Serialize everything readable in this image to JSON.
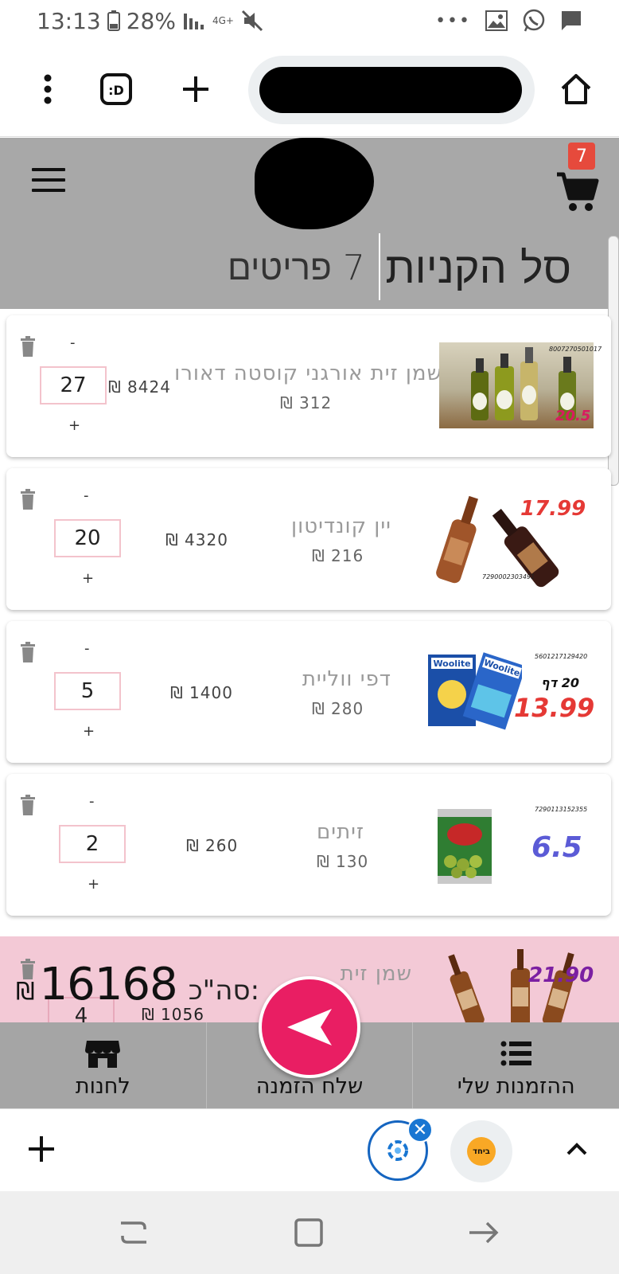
{
  "status_bar": {
    "time": "13:13",
    "battery": "28%",
    "network": "4G+"
  },
  "header": {
    "title": "סל הקניות",
    "items_count": "7 פריטים",
    "cart_badge": "7"
  },
  "cart_items": [
    {
      "name": "שמן זית אורגני קוסטה דאורו",
      "unit_price": "312 ₪",
      "line_total": "8424 ₪",
      "quantity": "27",
      "promo_price": "20.5",
      "barcode": "8007270501017"
    },
    {
      "name": "יין קונדיטון",
      "unit_price": "216 ₪",
      "line_total": "4320 ₪",
      "quantity": "20",
      "promo_price": "17.99",
      "barcode": "7290002303491"
    },
    {
      "name": "דפי ווליית",
      "unit_price": "280 ₪",
      "line_total": "1400 ₪",
      "quantity": "5",
      "promo_price": "13.99",
      "barcode": "5601217129420",
      "promo_note": "20 דף"
    },
    {
      "name": "זיתים",
      "unit_price": "130 ₪",
      "line_total": "260 ₪",
      "quantity": "2",
      "promo_price": "6.5",
      "barcode": "7290113152355"
    },
    {
      "name": "שמן זית",
      "unit_price": "",
      "line_total": "1056 ₪",
      "quantity": "4",
      "promo_price": "21.90"
    }
  ],
  "summary": {
    "total_label": "סה\"כ:",
    "total_value": "16168",
    "currency": "₪"
  },
  "qty_controls": {
    "minus": "-",
    "plus": "+"
  },
  "bottom_nav": {
    "stores": "לחנות",
    "send_order": "שלח הזמנה",
    "my_orders": "ההזמנות שלי"
  },
  "browser": {
    "tab_label": "ביחד",
    "ext_close": "✕"
  },
  "icons": {
    "menu": "hamburger-icon",
    "cart": "cart-icon",
    "trash": "trash-icon",
    "send": "send-icon",
    "store": "store-icon",
    "list": "list-icon"
  },
  "colors": {
    "header_bg": "#a8a8a8",
    "fab": "#e91e63",
    "badge": "#e64a3c",
    "qty_border": "#f3c3cc",
    "partial_bg": "#f3c9d6"
  }
}
